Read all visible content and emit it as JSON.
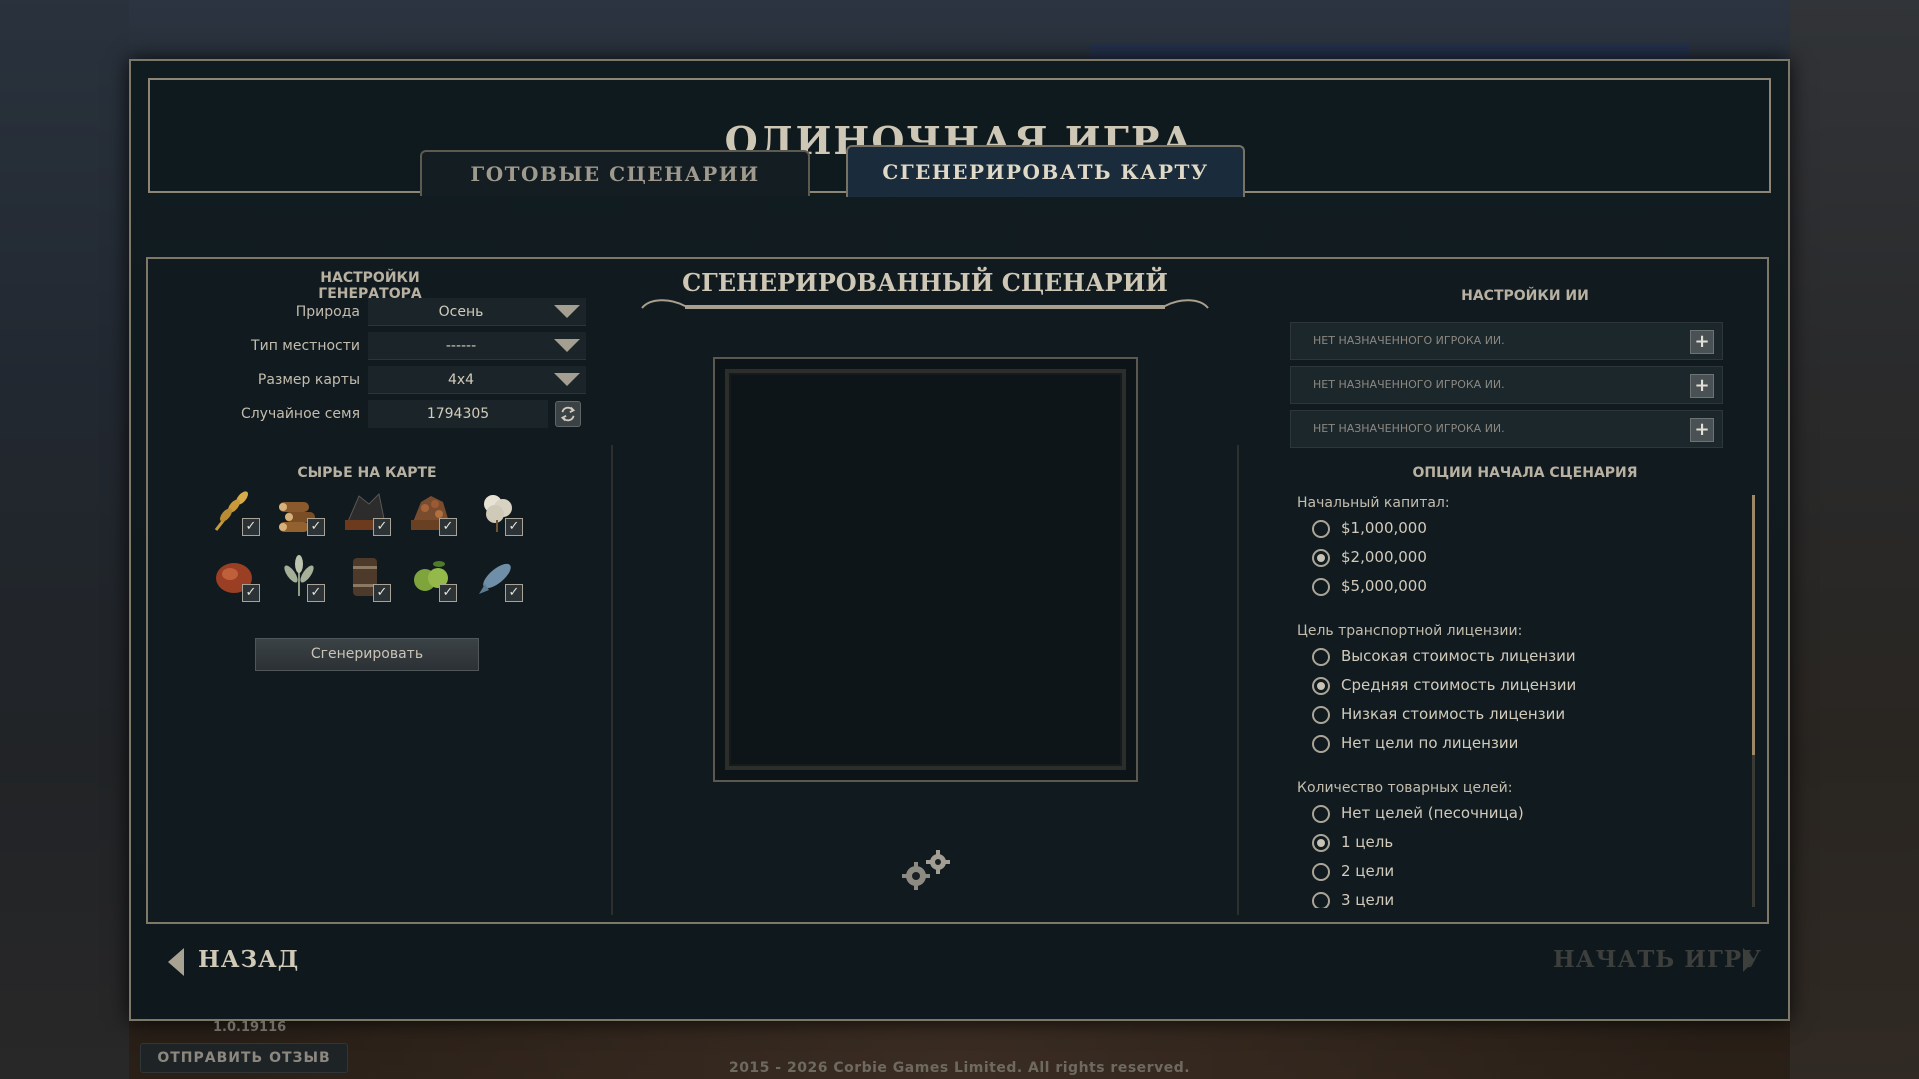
{
  "title": "ОДИНОЧНАЯ ИГРА",
  "tabs": [
    {
      "label": "ГОТОВЫЕ СЦЕНАРИИ",
      "active": false
    },
    {
      "label": "СГЕНЕРИРОВАТЬ КАРТУ",
      "active": true
    }
  ],
  "generator": {
    "title": "НАСТРОЙКИ ГЕНЕРАТОРА",
    "nature_label": "Природа",
    "nature_value": "Осень",
    "terrain_label": "Тип местности",
    "terrain_value": "------",
    "size_label": "Размер карты",
    "size_value": "4x4",
    "seed_label": "Случайное семя",
    "seed_value": "1794305",
    "resources_title": "СЫРЬЕ НА КАРТЕ",
    "resources": [
      {
        "icon": "wheat-icon",
        "checked": true
      },
      {
        "icon": "logs-icon",
        "checked": true
      },
      {
        "icon": "coal-icon",
        "checked": true
      },
      {
        "icon": "iron-ore-icon",
        "checked": true
      },
      {
        "icon": "cotton-icon",
        "checked": true
      },
      {
        "icon": "meat-icon",
        "checked": true
      },
      {
        "icon": "herbs-icon",
        "checked": true
      },
      {
        "icon": "oil-barrel-icon",
        "checked": true
      },
      {
        "icon": "fruit-icon",
        "checked": true
      },
      {
        "icon": "fish-icon",
        "checked": true
      }
    ],
    "generate_label": "Сгенерировать"
  },
  "scenario": {
    "title": "СГЕНЕРИРОВАННЫЙ СЦЕНАРИЙ"
  },
  "ai": {
    "title": "НАСТРОЙКИ ИИ",
    "slots": [
      "НЕТ НАЗНАЧЕННОГО ИГРОКА ИИ.",
      "НЕТ НАЗНАЧЕННОГО ИГРОКА ИИ.",
      "НЕТ НАЗНАЧЕННОГО ИГРОКА ИИ."
    ],
    "add_label": "+"
  },
  "options": {
    "title": "ОПЦИИ НАЧАЛА СЦЕНАРИЯ",
    "capital_label": "Начальный капитал:",
    "capital": [
      "$1,000,000",
      "$2,000,000",
      "$5,000,000"
    ],
    "capital_selected": 1,
    "license_label": "Цель транспортной лицензии:",
    "license": [
      "Высокая стоимость лицензии",
      "Средняя стоимость лицензии",
      "Низкая стоимость лицензии",
      "Нет цели по лицензии"
    ],
    "license_selected": 1,
    "goods_label": "Количество товарных целей:",
    "goods": [
      "Нет целей (песочница)",
      "1 цель",
      "2 цели",
      "3 цели"
    ],
    "goods_selected": 1
  },
  "footer": {
    "back_label": "НАЗАД",
    "start_label": "НАЧАТЬ ИГРУ",
    "version": "1.0.19116",
    "feedback_label": "ОТПРАВИТЬ ОТЗЫВ",
    "copyright": "2015 - 2026 Corbie Games Limited. All rights reserved."
  },
  "colors": {
    "panel": "#101a1f",
    "border": "#7e7869",
    "text": "#d2cbbb",
    "tab_active": "#1a2c3b",
    "scroll_thumb": "#9c8866"
  }
}
